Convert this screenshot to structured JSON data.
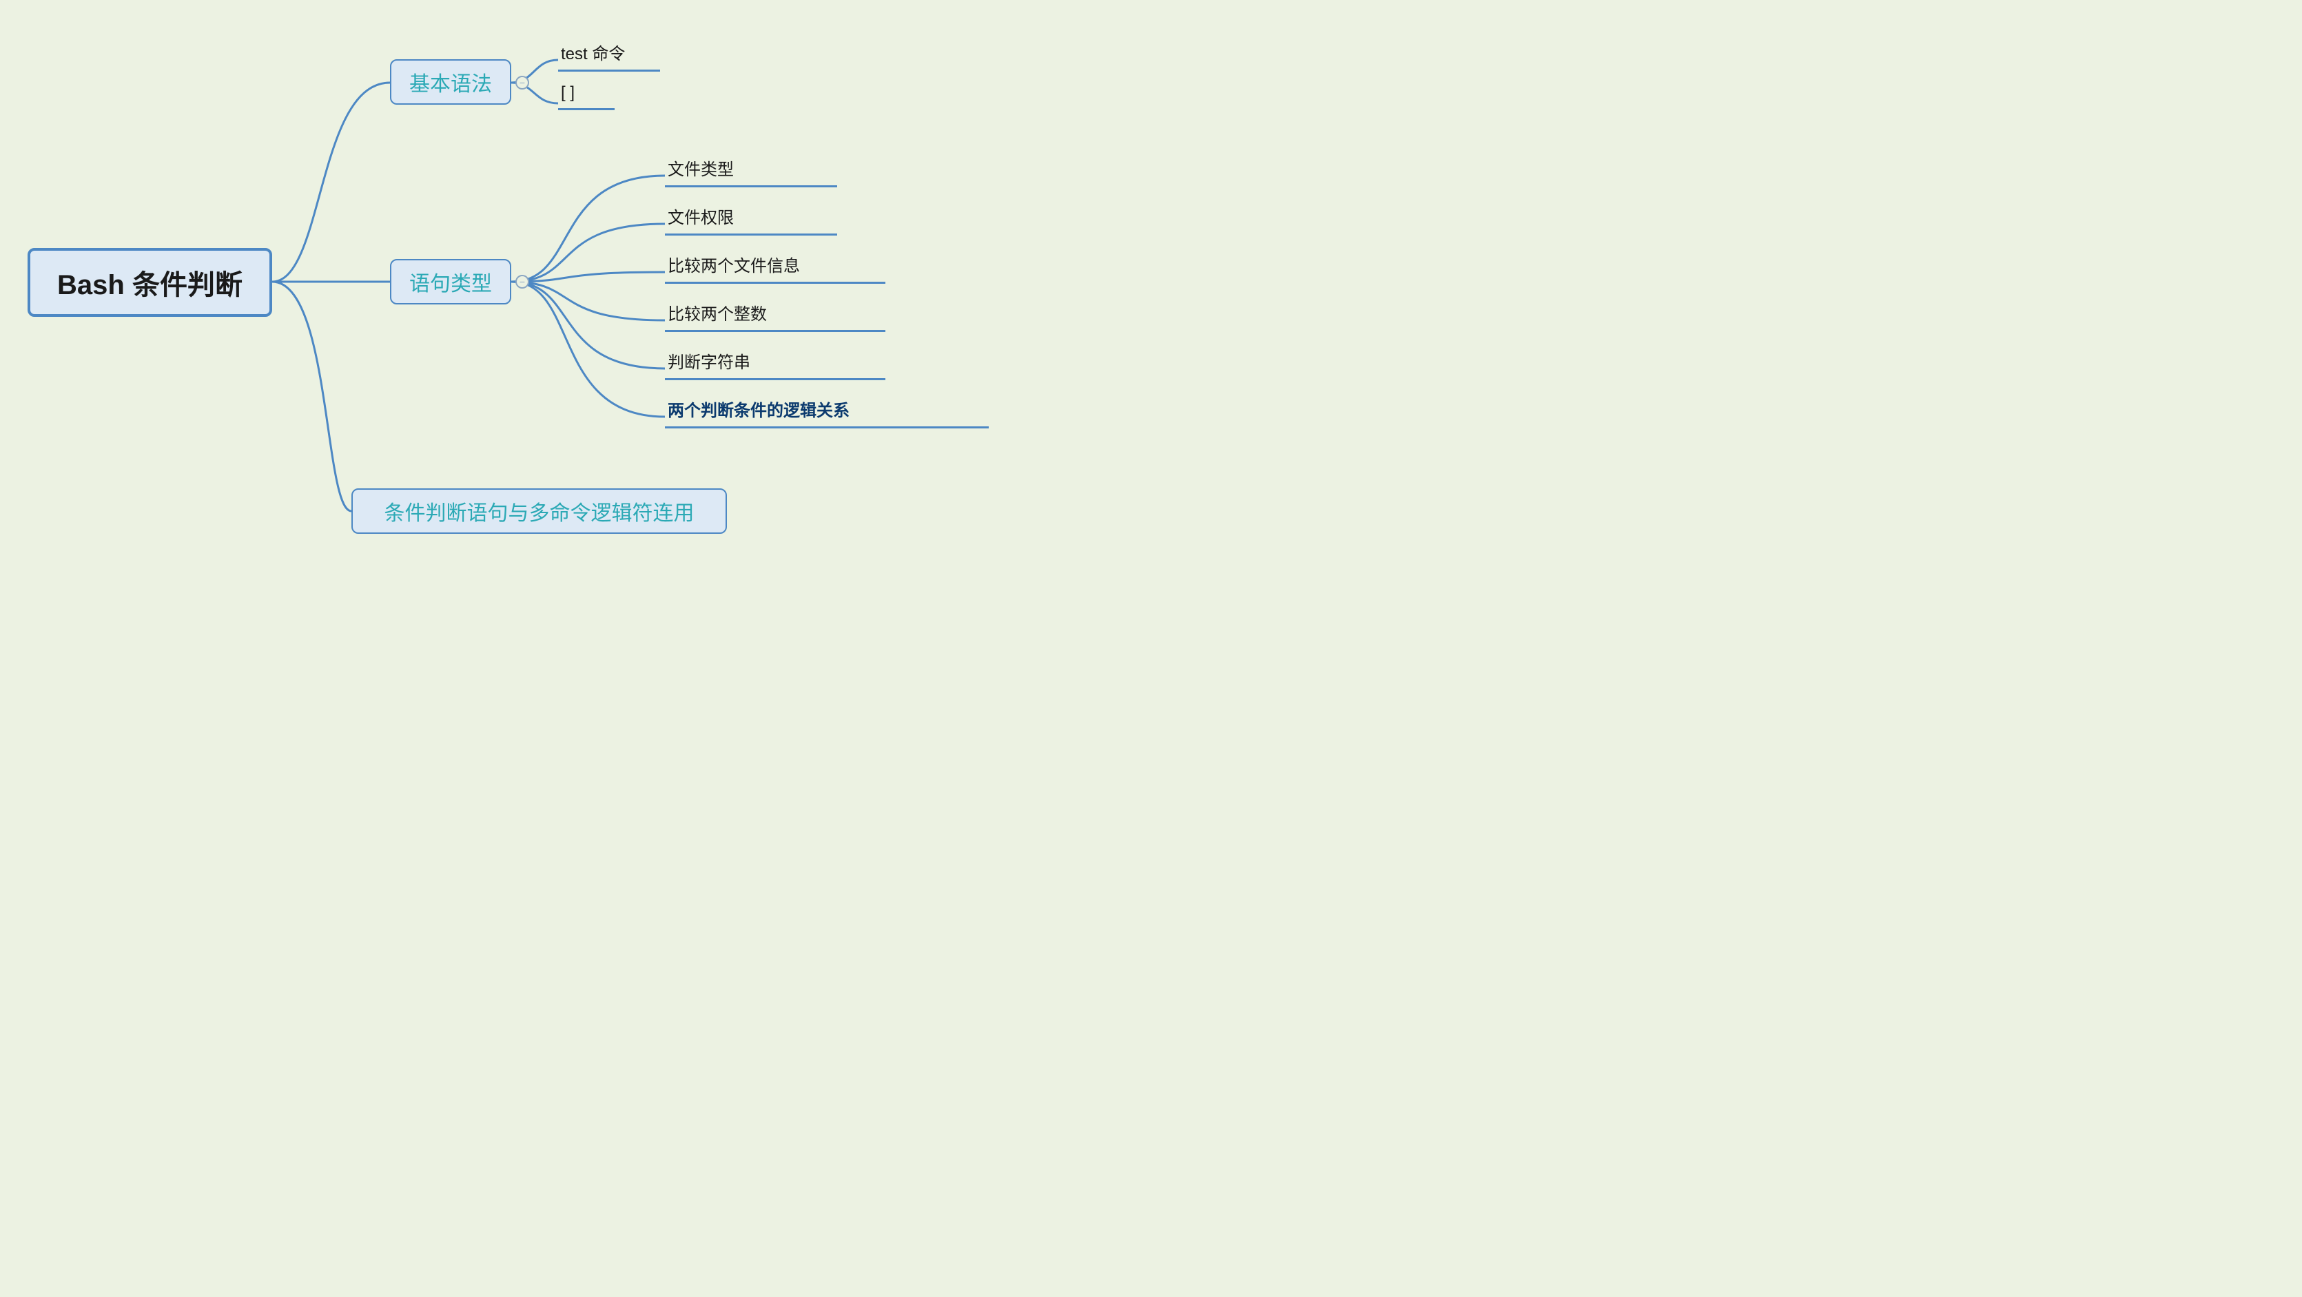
{
  "root": {
    "label": "Bash 条件判断"
  },
  "branches": [
    {
      "id": "syntax",
      "label": "基本语法",
      "children": [
        {
          "id": "test",
          "label": "test 命令",
          "bold": false
        },
        {
          "id": "brackets",
          "label": "[ ]",
          "bold": false
        }
      ]
    },
    {
      "id": "types",
      "label": "语句类型",
      "children": [
        {
          "id": "filetype",
          "label": "文件类型",
          "bold": false
        },
        {
          "id": "fileperm",
          "label": "文件权限",
          "bold": false
        },
        {
          "id": "fileinfo",
          "label": "比较两个文件信息",
          "bold": false
        },
        {
          "id": "intcmp",
          "label": "比较两个整数",
          "bold": false
        },
        {
          "id": "strcmp",
          "label": "判断字符串",
          "bold": false
        },
        {
          "id": "logic",
          "label": "两个判断条件的逻辑关系",
          "bold": true
        }
      ]
    },
    {
      "id": "combine",
      "label": "条件判断语句与多命令逻辑符连用",
      "children": []
    }
  ],
  "collapse_glyph": "−"
}
